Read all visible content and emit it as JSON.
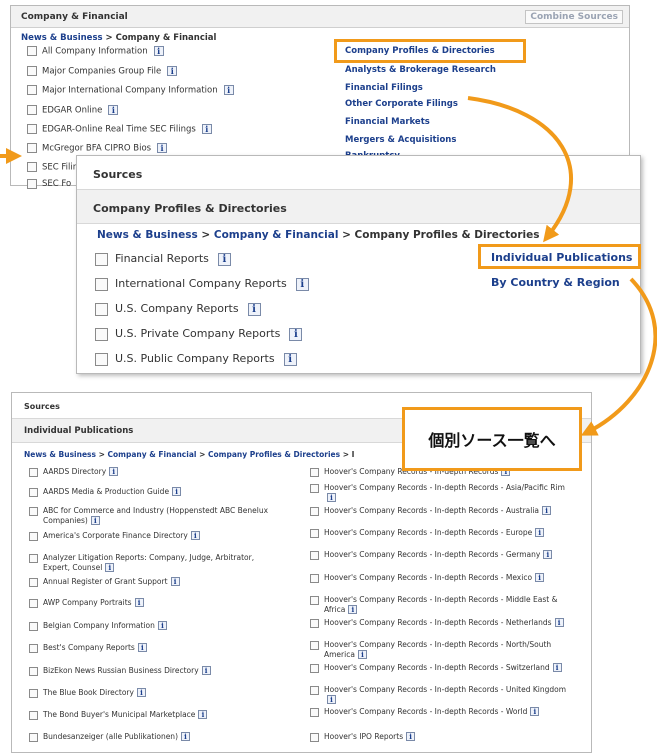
{
  "panel1": {
    "header": "Company & Financial",
    "combine_button": "Combine Sources",
    "breadcrumb": {
      "link": "News & Business",
      "sep": " > ",
      "current": "Company & Financial"
    },
    "items": [
      "All Company Information",
      "Major Companies Group File",
      "Major International Company Information",
      "EDGAR Online",
      "EDGAR-Online Real Time SEC Filings",
      "McGregor BFA CIPRO Bios",
      "SEC Filings - Full Text Only",
      "SEC Fo"
    ],
    "categories": [
      "Company Profiles & Directories",
      "Analysts & Brokerage Research",
      "Financial Filings",
      "Other Corporate Filings",
      "Financial Markets",
      "Mergers & Acquisitions",
      "Bankruptcy"
    ]
  },
  "panel2": {
    "header": "Sources",
    "subheader": "Company Profiles & Directories",
    "breadcrumb": {
      "link1": "News & Business",
      "sep1": " > ",
      "link2": "Company & Financial",
      "sep2": " > ",
      "current": "Company Profiles & Directories"
    },
    "items": [
      "Financial Reports",
      "International Company Reports",
      "U.S. Company Reports",
      "U.S. Private Company Reports",
      "U.S. Public Company Reports"
    ],
    "links": [
      "Individual Publications",
      "By Country & Region"
    ]
  },
  "panel3": {
    "header": "Sources",
    "subheader": "Individual Publications",
    "breadcrumb": {
      "link1": "News & Business",
      "sep1": " > ",
      "link2": "Company & Financial",
      "sep2": " > ",
      "link3": "Company Profiles & Directories",
      "sep3": " > ",
      "current": "I"
    },
    "left_items": [
      "AARDS Directory",
      "AARDS Media & Production Guide",
      "ABC for Commerce and Industry (Hoppenstedt ABC Benelux Companies)",
      "America's Corporate Finance Directory",
      "Analyzer Litigation Reports: Company, Judge, Arbitrator, Expert, Counsel",
      "Annual Register of Grant Support",
      "AWP Company Portraits",
      "Belgian Company Information",
      "Best's Company Reports",
      "BizEkon News Russian Business Directory",
      "The Blue Book Directory",
      "The Bond Buyer's Municipal Marketplace",
      "Bundesanzeiger (alle Publikationen)"
    ],
    "right_items": [
      "Hoover's Company Records - In-depth Records",
      "Hoover's Company Records - In-depth Records - Asia/Pacific Rim",
      "Hoover's Company Records - In-depth Records - Australia",
      "Hoover's Company Records - In-depth Records - Europe",
      "Hoover's Company Records - In-depth Records - Germany",
      "Hoover's Company Records - In-depth Records - Mexico",
      "Hoover's Company Records - In-depth Records - Middle East & Africa",
      "Hoover's Company Records - In-depth Records - Netherlands",
      "Hoover's Company Records - In-depth Records - North/South America",
      "Hoover's Company Records - In-depth Records - Switzerland",
      "Hoover's Company Records - In-depth Records - United Kingdom",
      "Hoover's Company Records - In-depth Records - World",
      "Hoover's IPO Reports"
    ]
  },
  "callout": {
    "text": "個別ソース一覧へ"
  },
  "info_glyph": "i",
  "colors": {
    "accent_orange": "#f19a1a",
    "link_blue": "#1c3f8c",
    "header_gray": "#f1f1f1"
  },
  "icons": {
    "info": "info-icon",
    "checkbox": "checkbox-icon",
    "arrow": "arrow-icon"
  }
}
